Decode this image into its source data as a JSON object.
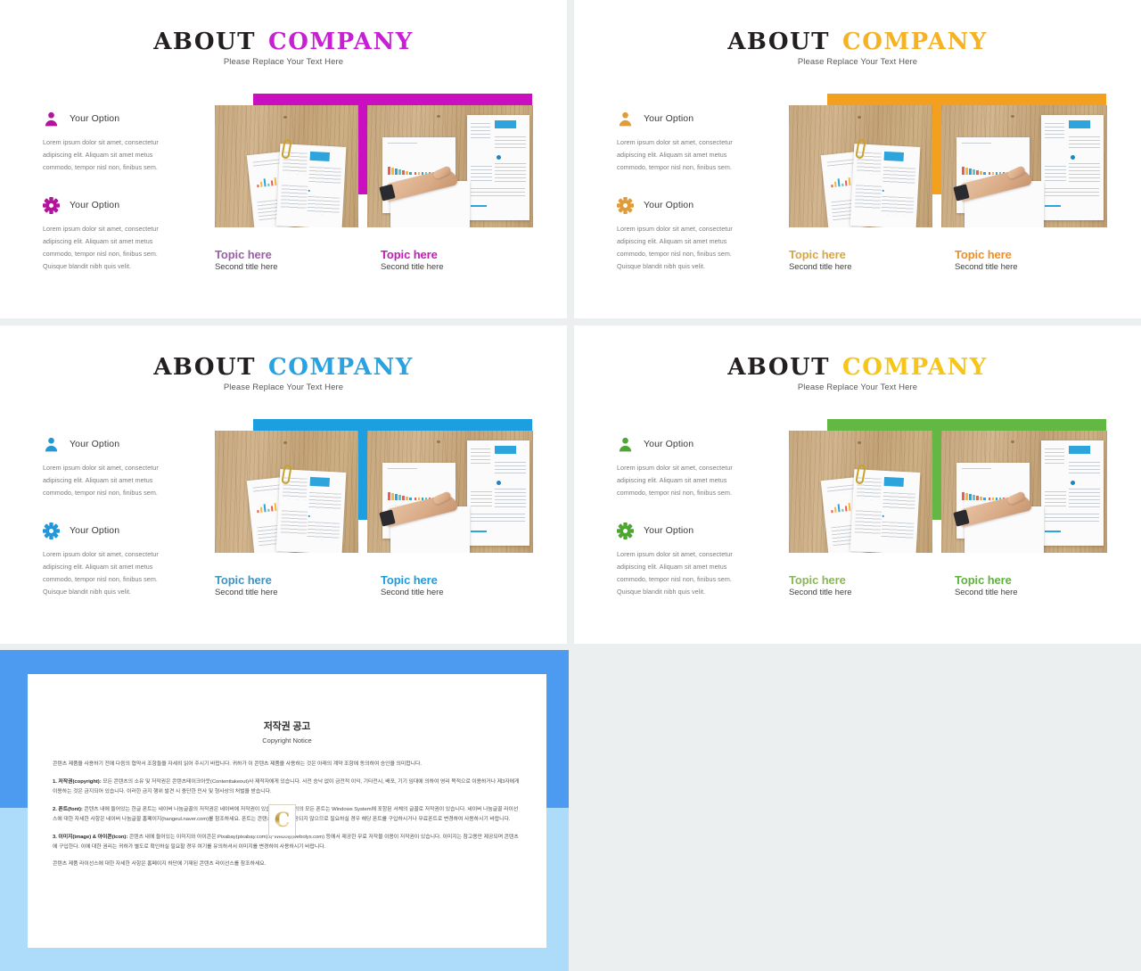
{
  "theme": {
    "gap_background": "#eceff0",
    "panel_background": "#ffffff"
  },
  "slides": [
    {
      "id": "magenta",
      "title_first": "ABOUT",
      "title_second": "COMPANY",
      "title_second_color": "#c81fd4",
      "subtitle": "Please Replace Your Text Here",
      "accent_color": "#c90fc0",
      "icon_color": "#b2149e",
      "caption_left_color": "#9b5fa8",
      "caption_right_color": "#c21bb8",
      "options": [
        {
          "icon": "person-icon",
          "label": "Your Option",
          "body": "Lorem ipsum dolor sit amet, consectetur adipiscing elit. Aliquam sit amet metus commodo, tempor nisl non, finibus sem."
        },
        {
          "icon": "gear-icon",
          "label": "Your Option",
          "body": "Lorem ipsum dolor sit amet, consectetur adipiscing elit. Aliquam sit amet metus commodo, tempor nisl non, finibus sem. Quisque blandit nibh quis velit."
        }
      ],
      "captions": [
        {
          "title": "Topic here",
          "subtitle": "Second title here"
        },
        {
          "title": "Topic here",
          "subtitle": "Second title here"
        }
      ]
    },
    {
      "id": "orange",
      "title_first": "ABOUT",
      "title_second": "COMPANY",
      "title_second_color": "#f5b223",
      "subtitle": "Please Replace Your Text Here",
      "accent_color": "#f2a01e",
      "icon_color": "#e09b3a",
      "caption_left_color": "#d9a545",
      "caption_right_color": "#ef8e23",
      "options": [
        {
          "icon": "person-icon",
          "label": "Your Option",
          "body": "Lorem ipsum dolor sit amet, consectetur adipiscing elit. Aliquam sit amet metus commodo, tempor nisl non, finibus sem."
        },
        {
          "icon": "gear-icon",
          "label": "Your Option",
          "body": "Lorem ipsum dolor sit amet, consectetur adipiscing elit. Aliquam sit amet metus commodo, tempor nisl non, finibus sem. Quisque blandit nibh quis velit."
        }
      ],
      "captions": [
        {
          "title": "Topic here",
          "subtitle": "Second title here"
        },
        {
          "title": "Topic here",
          "subtitle": "Second title here"
        }
      ]
    },
    {
      "id": "blue",
      "title_first": "ABOUT",
      "title_second": "COMPANY",
      "title_second_color": "#28a2e0",
      "subtitle": "Please Replace Your Text Here",
      "accent_color": "#1c9fe0",
      "icon_color": "#2497d6",
      "caption_left_color": "#3f94c4",
      "caption_right_color": "#1f9bdc",
      "options": [
        {
          "icon": "person-icon",
          "label": "Your Option",
          "body": "Lorem ipsum dolor sit amet, consectetur adipiscing elit. Aliquam sit amet metus commodo, tempor nisl non, finibus sem."
        },
        {
          "icon": "gear-icon",
          "label": "Your Option",
          "body": "Lorem ipsum dolor sit amet, consectetur adipiscing elit. Aliquam sit amet metus commodo, tempor nisl non, finibus sem. Quisque blandit nibh quis velit."
        }
      ],
      "captions": [
        {
          "title": "Topic here",
          "subtitle": "Second title here"
        },
        {
          "title": "Topic here",
          "subtitle": "Second title here"
        }
      ]
    },
    {
      "id": "green",
      "title_first": "ABOUT",
      "title_second": "COMPANY",
      "title_second_color": "#f6c518",
      "subtitle": "Please Replace Your Text Here",
      "accent_color": "#63b843",
      "icon_color": "#4ea534",
      "caption_left_color": "#8cb55c",
      "caption_right_color": "#5fb23f",
      "options": [
        {
          "icon": "person-icon",
          "label": "Your Option",
          "body": "Lorem ipsum dolor sit amet, consectetur adipiscing elit. Aliquam sit amet metus commodo, tempor nisl non, finibus sem."
        },
        {
          "icon": "gear-icon",
          "label": "Your Option",
          "body": "Lorem ipsum dolor sit amet, consectetur adipiscing elit. Aliquam sit amet metus commodo, tempor nisl non, finibus sem. Quisque blandit nibh quis velit."
        }
      ],
      "captions": [
        {
          "title": "Topic here",
          "subtitle": "Second title here"
        },
        {
          "title": "Topic here",
          "subtitle": "Second title here"
        }
      ]
    }
  ],
  "copyright": {
    "frame_color_top": "#4d9bf0",
    "frame_color_bottom": "#addcfb",
    "title": "저작권 공고",
    "subtitle": "Copyright Notice",
    "watermark_letter": "C",
    "intro": "콘텐츠 제품을 사용하기 전에 다음의 협약서 조항들을 자세히 읽어 주시기 바랍니다. 귀하가 이 콘텐츠 제품을 사용하는 것은 아래의 계약 조항에 동의하여 승인을 의미합니다.",
    "paragraphs": [
      {
        "heading": "1. 저작권(copyright):",
        "text": " 모든 콘텐츠의 소유 및 저작권은 콘텐츠테이크아웃(Contenttakeout)사 제작자에게 있습니다. 사전 승낙 없이 금전적 이익, 기타전시, 배포, 기기 임대에 의하여 영리 목적으로 이용하거나 제3자에게 이용하는 것은 금지되어 있습니다. 이러한 금지 행위 발견 시 중단한 민사 및 형사상의 처벌을 받습니다."
      },
      {
        "heading": "2. 폰트(font):",
        "text": " 콘텐츠 내에 들어있는 한글 폰트는 네이버 나눔글꼴의 저작권은 네이버에 저작권이 있습니다. 한글 외의 모든 폰트는 Windows System에 포함된 서체의 글꼴로 저작권이 있습니다. 네이버 나눔글꼴 라이선스에 대한 자세한 사항은 네이버 나눔글꼴 홈페이지(hangeul.naver.com)를 참조하세요. 폰트는 콘텐츠의 일에 제공되지 않으므로 필요하실 경우 해당 폰트를 구입하시거나 무료폰트로 변경하여 사용하시기 바랍니다."
      },
      {
        "heading": "3. 이미지(image) & 아이콘(icon):",
        "text": " 콘텐츠 내에 들어있는 이미지와 아이콘은 Pixabay(pixabay.com)와 Weboly(webolys.com) 등에서 제공한 무료 저작물 이용이 저작권이 있습니다. 이미지는 참고용만 제공되며 콘텐츠에 구입한다. 이에 대한 권리는 귀하가 별도로 확인하실 필요할 경우 여기를 유의하셔서 이미지를 변경하여 사용하시기 바랍니다."
      }
    ],
    "outro": "콘텐츠 제품 라이선스에 대한 자세한 사항은 홈페이지 하단에 기재된 콘텐츠 라이선스를 참조하세요."
  }
}
